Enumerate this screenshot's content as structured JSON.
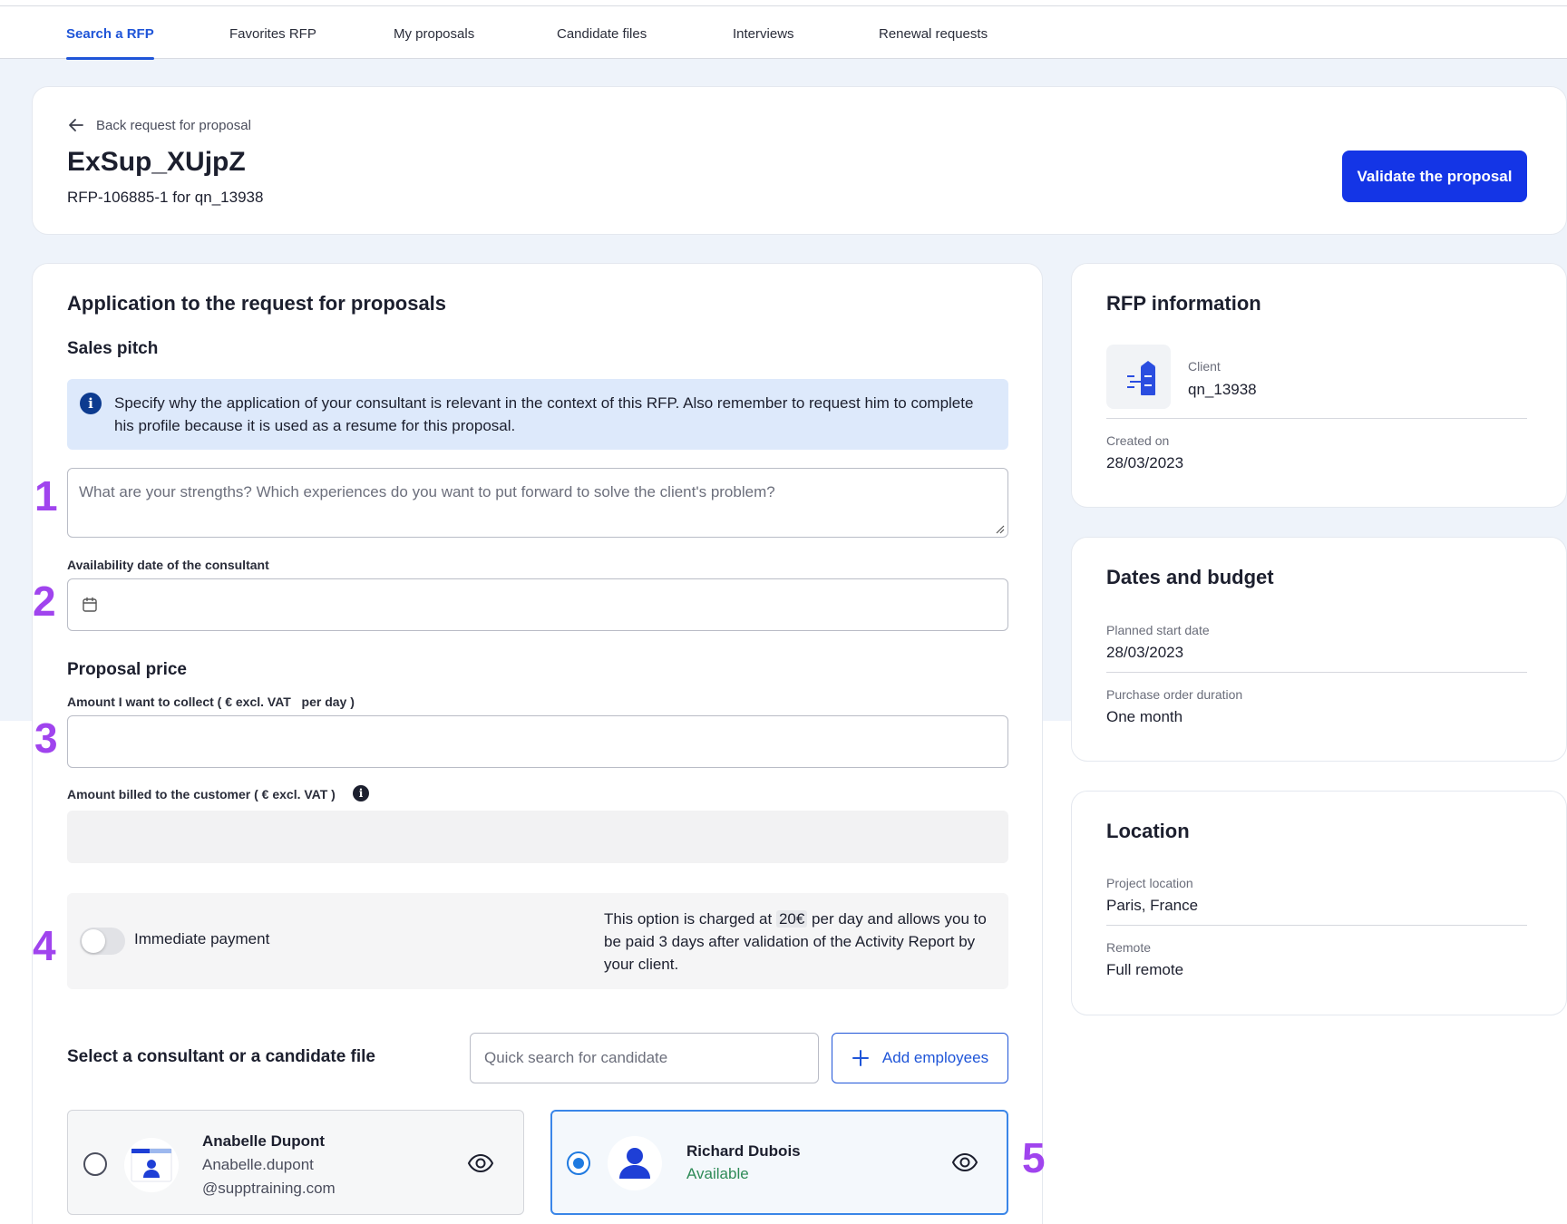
{
  "nav": {
    "tabs": [
      {
        "label": "Search a RFP",
        "active": true
      },
      {
        "label": "Favorites RFP"
      },
      {
        "label": "My proposals"
      },
      {
        "label": "Candidate files"
      },
      {
        "label": "Interviews"
      },
      {
        "label": "Renewal requests"
      }
    ]
  },
  "header": {
    "back_label": "Back request for proposal",
    "title": "ExSup_XUjpZ",
    "subtitle": "RFP-106885-1 for qn_13938",
    "validate_label": "Validate the proposal"
  },
  "application": {
    "heading": "Application to the request for proposals",
    "sales_pitch_heading": "Sales pitch",
    "info_text": "Specify why the application of your consultant is relevant in the context of this RFP. Also remember to request him to complete his profile because it is used as a resume for this proposal.",
    "pitch_placeholder": "What are your strengths? Which experiences do you want to put forward to solve the client's problem?",
    "availability_label": "Availability date of the consultant",
    "price_heading": "Proposal price",
    "amount_collect_label": "Amount I want to collect ( € excl. VAT   per day )",
    "amount_billed_label": "Amount billed to the customer ( € excl. VAT )",
    "immediate_payment_label": "Immediate payment",
    "immediate_payment_enabled": false,
    "immediate_desc_before": "This option is charged at ",
    "immediate_desc_chip": "20€",
    "immediate_desc_after": " per day and allows you to be paid 3 days after validation of the Activity Report by your client.",
    "select_heading": "Select a consultant or a candidate file",
    "search_placeholder": "Quick search for candidate",
    "add_employees_label": "Add employees",
    "candidates": [
      {
        "name": "Anabelle Dupont",
        "line1": "Anabelle.dupont",
        "line2": "@supptraining.com",
        "selected": false
      },
      {
        "name": "Richard Dubois",
        "status": "Available",
        "selected": true
      }
    ]
  },
  "markers": [
    "1",
    "2",
    "3",
    "4",
    "5"
  ],
  "rfp_info": {
    "heading": "RFP information",
    "client_label": "Client",
    "client_value": "qn_13938",
    "created_label": "Created on",
    "created_value": "28/03/2023"
  },
  "dates_budget": {
    "heading": "Dates and budget",
    "start_label": "Planned start date",
    "start_value": "28/03/2023",
    "duration_label": "Purchase order duration",
    "duration_value": "One month"
  },
  "location": {
    "heading": "Location",
    "project_label": "Project location",
    "project_value": "Paris, France",
    "remote_label": "Remote",
    "remote_value": "Full remote"
  },
  "colors": {
    "accent": "#1f55d8",
    "primary_button": "#1435e6",
    "marker": "#a044ee",
    "available": "#2e8b57",
    "page_bg": "#eef3fa"
  }
}
